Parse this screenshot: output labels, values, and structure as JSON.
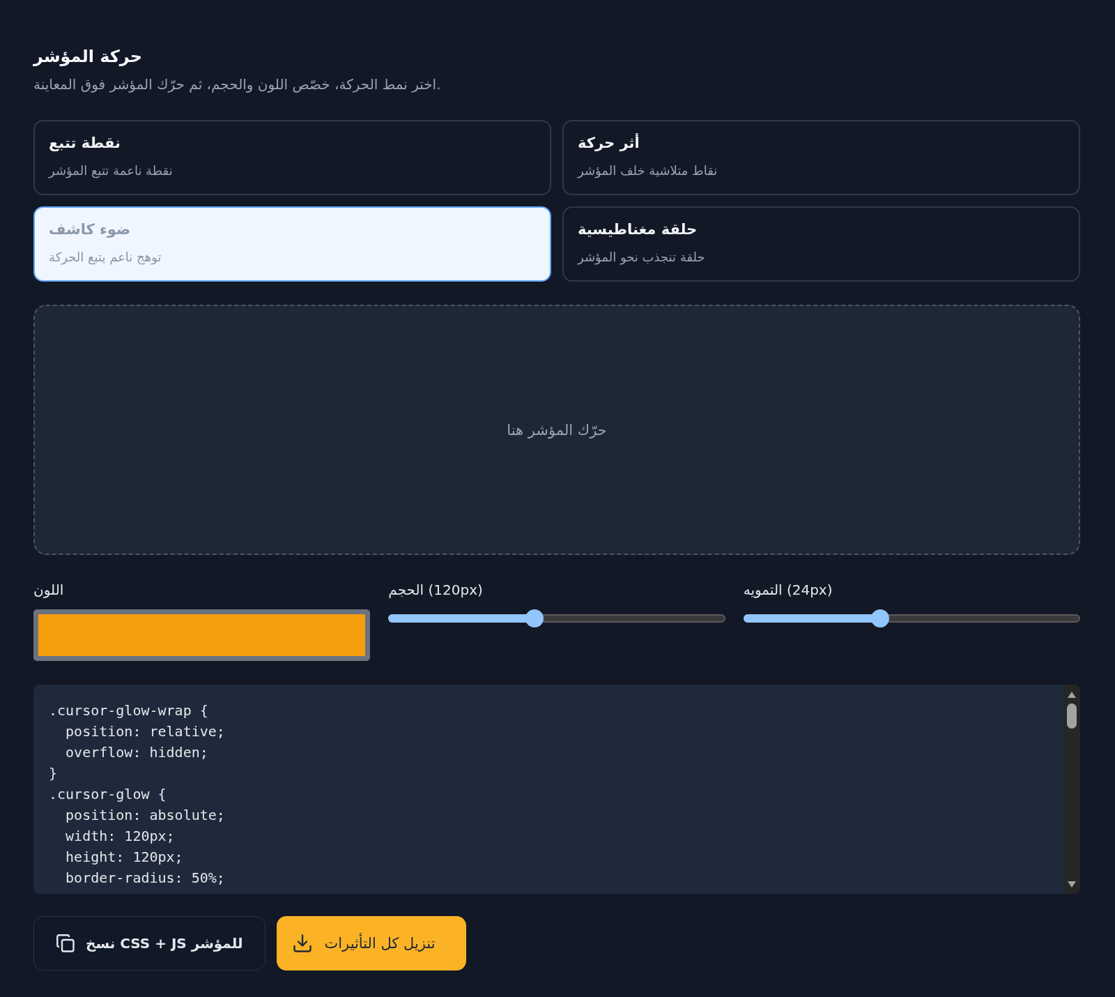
{
  "header": {
    "title": "حركة المؤشر",
    "subtitle": "اختر نمط الحركة، خصّص اللون والحجم، ثم حرّك المؤشر فوق المعاينة."
  },
  "modes": [
    {
      "title": "أثر حركة",
      "description": "نقاط متلاشية خلف المؤشر",
      "selected": false
    },
    {
      "title": "نقطة تتبع",
      "description": "نقطة ناعمة تتبع المؤشر",
      "selected": false
    },
    {
      "title": "حلقة مغناطيسية",
      "description": "حلقة تنجذب نحو المؤشر",
      "selected": false
    },
    {
      "title": "ضوء كاشف",
      "description": "توهج ناعم يتبع الحركة",
      "selected": true
    }
  ],
  "preview": {
    "hint": "حرّك المؤشر هنا"
  },
  "controls": [
    {
      "kind": "slider",
      "label": "التمويه (24px)",
      "level": 0.4
    },
    {
      "kind": "slider",
      "label": "الحجم (120px)",
      "level": 0.43
    },
    {
      "kind": "color",
      "label": "اللون",
      "color": "#f59e0b"
    }
  ],
  "code": {
    "lines": [
      ".cursor-glow-wrap {",
      "  position: relative;",
      "  overflow: hidden;",
      "}",
      ".cursor-glow {",
      "  position: absolute;",
      "  width: 120px;",
      "  height: 120px;",
      "  border-radius: 50%;"
    ]
  },
  "buttons": [
    {
      "kind": "primary",
      "label": "تنزيل كل التأثيرات"
    },
    {
      "kind": "secondary",
      "label": "نسخ CSS + JS للمؤشر"
    }
  ]
}
